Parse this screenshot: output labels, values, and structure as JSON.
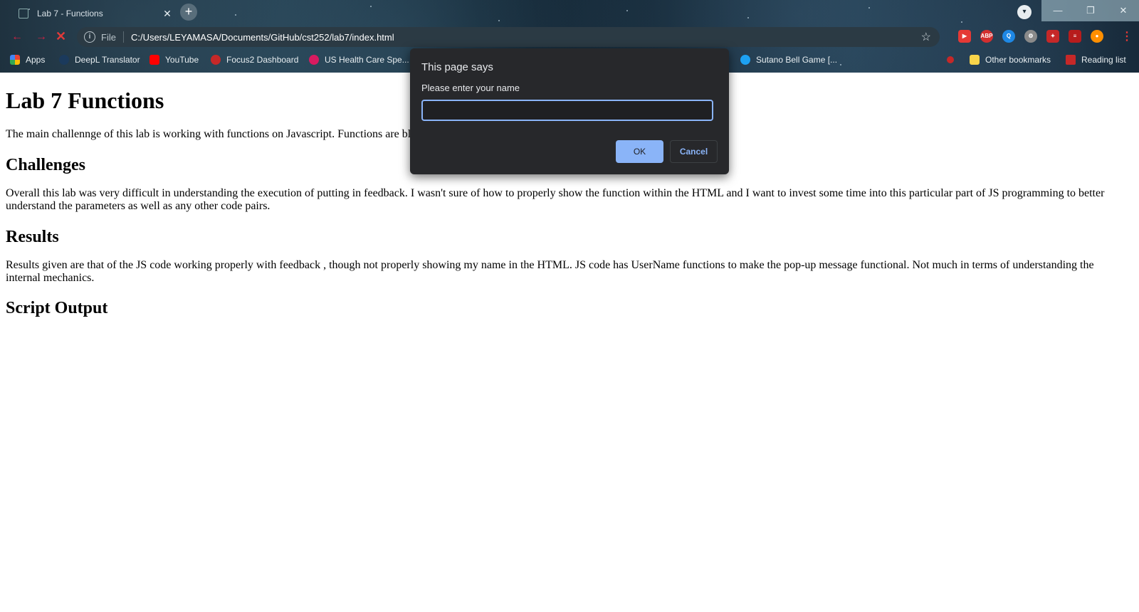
{
  "browser": {
    "tab": {
      "title": "Lab 7 - Functions",
      "close": "✕"
    },
    "new_tab": "+",
    "profile_menu": "▾",
    "window": {
      "minimize": "—",
      "maximize": "❐",
      "close": "✕"
    },
    "toolbar": {
      "back": "←",
      "forward": "→",
      "stop": "✕",
      "info_icon": "i",
      "scheme": "File",
      "url": "C:/Users/LEYAMASA/Documents/GitHub/cst252/lab7/index.html",
      "bookmark_star": "☆",
      "menu": "⋮"
    },
    "extensions": [
      "▶",
      "ABP",
      "Q",
      "⚙",
      "✦",
      "≡",
      "●"
    ],
    "bookmarks": {
      "apps": "Apps",
      "deepl": "DeepL Translator",
      "youtube": "YouTube",
      "focus": "Focus2 Dashboard",
      "ushc": "US Health Care Spe...",
      "bell": "Sutano Bell Game [...",
      "other": "Other bookmarks",
      "reading": "Reading list"
    }
  },
  "page": {
    "title": "Lab 7 Functions",
    "intro": "The main challennge of this lab is working with functions on Javascript. Functions are bl",
    "challenges_heading": "Challenges",
    "challenges_text": "Overall this lab was very difficult in understanding the execution of putting in feedback. I wasn't sure of how to properly show the function within the HTML and I want to invest some time into this particular part of JS programming to better understand the parameters as well as any other code pairs.",
    "results_heading": "Results",
    "results_text": "Results given are that of the JS code working properly with feedback , though not properly showing my name in the HTML. JS code has UserName functions to make the pop-up message functional. Not much in terms of understanding the internal mechanics.",
    "script_heading": "Script Output"
  },
  "dialog": {
    "title": "This page says",
    "message": "Please enter your name",
    "input_value": "",
    "ok": "OK",
    "cancel": "Cancel"
  },
  "colors": {
    "dialog_bg": "#27282b",
    "accent": "#8ab4f8"
  }
}
